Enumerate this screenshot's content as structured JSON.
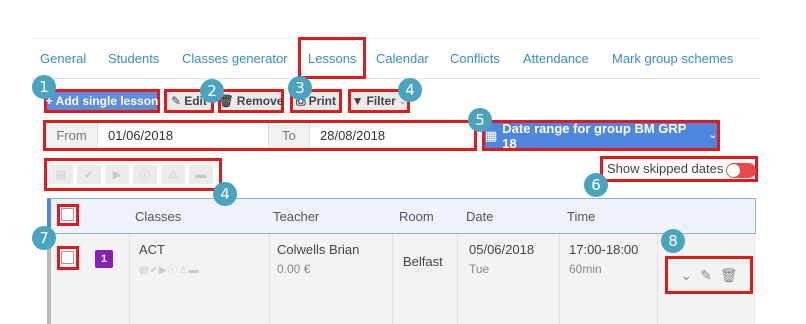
{
  "tabs": [
    {
      "label": "General"
    },
    {
      "label": "Students"
    },
    {
      "label": "Classes generator"
    },
    {
      "label": "Lessons"
    },
    {
      "label": "Calendar"
    },
    {
      "label": "Conflicts"
    },
    {
      "label": "Attendance"
    },
    {
      "label": "Mark group schemes"
    }
  ],
  "active_tab": "Lessons",
  "toolbar": {
    "add_label": "Add single lesson",
    "edit_label": "Edit",
    "remove_label": "Remove",
    "print_label": "Print",
    "filter_label": "Filter"
  },
  "dates": {
    "from_label": "From",
    "from_value": "01/06/2018",
    "to_label": "To",
    "to_value": "28/08/2018",
    "range_label": "Date range for group BM GRP 18"
  },
  "skip": {
    "label": "Show skipped dates"
  },
  "table": {
    "headers": {
      "classes": "Classes",
      "teacher": "Teacher",
      "room": "Room",
      "date": "Date",
      "time": "Time"
    },
    "rows": [
      {
        "badge": "1",
        "classes": "ACT",
        "teacher": "Colwells Brian",
        "price": "0.00 €",
        "room": "Belfast",
        "date": "05/06/2018",
        "weekday": "Tue",
        "time": "17:00-18:00",
        "duration": "60min"
      }
    ]
  },
  "callouts": [
    "1",
    "2",
    "3",
    "4",
    "5",
    "4",
    "6",
    "7",
    "8"
  ],
  "colors": {
    "highlight": "#e01b1b",
    "primary": "#5d8de0",
    "callout": "#4aa3bf",
    "badge": "#8a1fb7",
    "toggle": "#e8484a"
  }
}
